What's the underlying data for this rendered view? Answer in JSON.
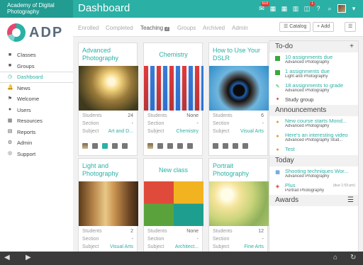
{
  "app": {
    "brand": "Academy of Digital Photography",
    "page_title": "Dashboard",
    "logo_text": "ADP",
    "mail_badge": "619",
    "cart_badge": "1"
  },
  "sidebar": {
    "items": [
      {
        "label": "Classes",
        "icon": "classes-icon",
        "glyph": "■"
      },
      {
        "label": "Groups",
        "icon": "groups-icon",
        "glyph": "■"
      },
      {
        "label": "Dashboard",
        "icon": "dashboard-icon",
        "glyph": "◷"
      },
      {
        "label": "News",
        "icon": "news-icon",
        "glyph": "🔔"
      },
      {
        "label": "Welcome",
        "icon": "welcome-icon",
        "glyph": "⚑"
      },
      {
        "label": "Users",
        "icon": "users-icon",
        "glyph": "●"
      },
      {
        "label": "Resources",
        "icon": "resources-icon",
        "glyph": "▦"
      },
      {
        "label": "Reports",
        "icon": "reports-icon",
        "glyph": "▤"
      },
      {
        "label": "Admin",
        "icon": "admin-icon",
        "glyph": "⚙"
      },
      {
        "label": "Support",
        "icon": "support-icon",
        "glyph": "◎"
      }
    ]
  },
  "tabs": {
    "enrolled": "Enrolled",
    "completed": "Completed",
    "teaching": "Teaching",
    "teaching_count": "7",
    "groups": "Groups",
    "archived": "Archived",
    "admin": "Admin",
    "catalog_btn": "Catalog",
    "add_btn": "Add"
  },
  "cards": [
    {
      "title": "Advanced Photography",
      "students_label": "Students",
      "students": "24",
      "section_label": "Section",
      "section": "-",
      "subject_label": "Subject",
      "subject": "Art and D..."
    },
    {
      "title": "Chemistry",
      "students_label": "Students",
      "students": "None",
      "section_label": "Section",
      "section": "-",
      "subject_label": "Subject",
      "subject": "Chemistry"
    },
    {
      "title": "How to Use Your DSLR",
      "students_label": "Students",
      "students": "6",
      "section_label": "Section",
      "section": "-",
      "subject_label": "Subject",
      "subject": "Visual Arts"
    },
    {
      "title": "Light and Photography",
      "students_label": "Students",
      "students": "2",
      "section_label": "Section",
      "section": "-",
      "subject_label": "Subject",
      "subject": "Visual Arts"
    },
    {
      "title": "New class",
      "students_label": "Students",
      "students": "None",
      "section_label": "Section",
      "section": "-",
      "subject_label": "Subject",
      "subject": "Architect..."
    },
    {
      "title": "Portrait Photography",
      "students_label": "Students",
      "students": "12",
      "section_label": "Section",
      "section": "-",
      "subject_label": "Subject",
      "subject": "Fine Arts"
    }
  ],
  "todo": {
    "title": "To-do",
    "items": [
      {
        "title": "10 assignments due",
        "sub": "Advanced Photography"
      },
      {
        "title": "1 assignments due",
        "sub": "Light and Photography"
      },
      {
        "title": "18 assignments to grade",
        "sub": "Advanced Photography"
      },
      {
        "title": "Study group",
        "sub": ""
      }
    ]
  },
  "announcements": {
    "title": "Announcements",
    "items": [
      {
        "title": "New course starts Mond...",
        "sub": "Advanced Photography"
      },
      {
        "title": "Here's an interesting video",
        "sub": "Advanced Photography Stud..."
      },
      {
        "title": "Test",
        "sub": ""
      }
    ]
  },
  "today": {
    "title": "Today",
    "items": [
      {
        "title": "Shooting techniques Wor...",
        "sub": "Advanced Photography",
        "time": ""
      },
      {
        "title": "Plus",
        "sub": "Portrait Photography",
        "time": "(due 1:59 pm)"
      }
    ]
  },
  "awards": {
    "title": "Awards"
  },
  "colors": {
    "accent": "#2bb0a5",
    "brand_bg": "#229b91",
    "bottom_bar": "#3b3b3b"
  }
}
